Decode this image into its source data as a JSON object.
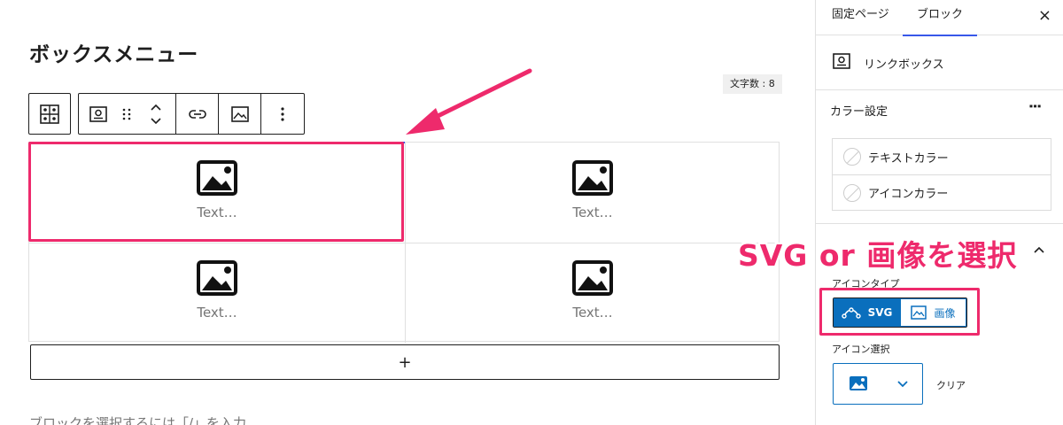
{
  "editor": {
    "page_title": "ボックスメニュー",
    "char_count": "文字数 : 8",
    "cells": [
      {
        "text": "Text…"
      },
      {
        "text": "Text…"
      },
      {
        "text": "Text…"
      },
      {
        "text": "Text…"
      }
    ],
    "add_block": "+",
    "hint": "ブロックを選択するには「/」を入力"
  },
  "sidebar": {
    "tabs": [
      {
        "label": "固定ページ"
      },
      {
        "label": "ブロック"
      }
    ],
    "active_tab": "ブロック",
    "close": "×",
    "block_name": "リンクボックス",
    "color_settings": {
      "title": "カラー設定",
      "menu": "⋮",
      "items": [
        {
          "label": "テキストカラー"
        },
        {
          "label": "アイコンカラー"
        }
      ]
    },
    "icon_type": {
      "label": "アイコンタイプ",
      "options": [
        {
          "label": "SVG",
          "selected": true
        },
        {
          "label": "画像",
          "selected": false
        }
      ]
    },
    "icon_select": {
      "label": "アイコン選択",
      "clear": "クリア"
    }
  },
  "annotation": {
    "callout": "SVG or 画像を選択",
    "color": "#ee2a6c"
  },
  "colors": {
    "accent": "#3858e9",
    "button_blue": "#0a6fbd",
    "annotation_pink": "#ee2a6c"
  }
}
